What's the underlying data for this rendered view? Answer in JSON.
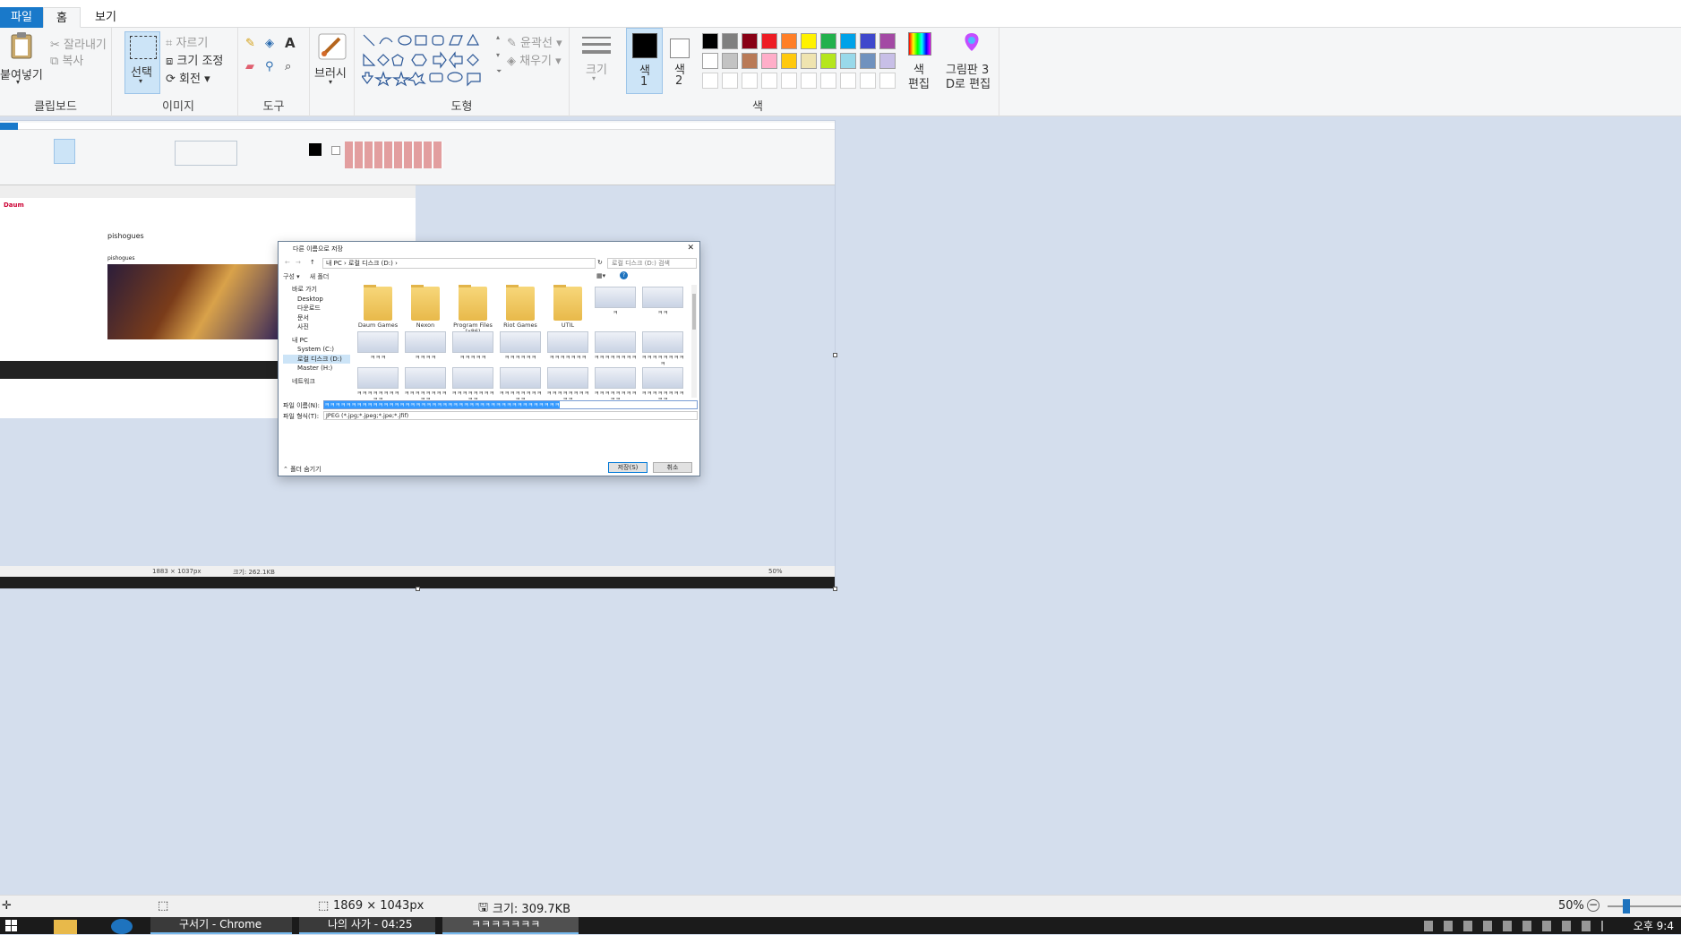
{
  "tabs": {
    "file": "파일",
    "home": "홈",
    "view": "보기"
  },
  "clipboard": {
    "paste": "붙여넣기",
    "cut": "잘라내기",
    "copy": "복사",
    "label": "클립보드"
  },
  "image": {
    "select": "선택",
    "crop": "자르기",
    "resize": "크기 조정",
    "rotate": "회전",
    "label": "이미지"
  },
  "tools": {
    "label": "도구"
  },
  "brushes": {
    "label": "브러시"
  },
  "shapes": {
    "outline": "윤곽선",
    "fill": "채우기",
    "label": "도형"
  },
  "size": {
    "label": "크기"
  },
  "colors": {
    "color1": "색\n1",
    "color1_a": "색",
    "color1_b": "1",
    "color2_a": "색",
    "color2_b": "2",
    "edit_a": "색",
    "edit_b": "편집",
    "paint3d_a": "그림판 3",
    "paint3d_b": "D로 편집",
    "label": "색",
    "palette_row1": [
      "#000000",
      "#7f7f7f",
      "#880015",
      "#ed1c24",
      "#ff7f27",
      "#fff200",
      "#22b14c",
      "#00a2e8",
      "#3f48cc",
      "#a349a4"
    ],
    "palette_row2": [
      "#ffffff",
      "#c3c3c3",
      "#b97a57",
      "#ffaec9",
      "#ffc90e",
      "#efe4b0",
      "#b5e61d",
      "#99d9ea",
      "#7092be",
      "#c8bfe7"
    ]
  },
  "inner": {
    "page_title": "pishogues",
    "page_subtitle": "pishogues",
    "status_dims": "1883 × 1037px",
    "status_size": "크기: 262.1KB",
    "zoom": "50%"
  },
  "dialog": {
    "title": "다른 이름으로 저장",
    "path": "내 PC  ›  로컬 디스크 (D:)  ›",
    "search_placeholder": "로컬 디스크 (D:) 검색",
    "organize": "구성 ▾",
    "new_folder": "새 폴더",
    "nav": [
      "바로 가기",
      "Desktop",
      "다운로드",
      "문서",
      "사진",
      "",
      "내 PC",
      "System (C:)",
      "로컬 디스크 (D:)",
      "Master (H:)",
      "",
      "네트워크"
    ],
    "folders": [
      "Daum Games",
      "Nexon",
      "Program Files (x86)",
      "Riot Games",
      "UTIL",
      "ㅋ",
      "ㅋㅋ"
    ],
    "files_row2": [
      "ㅋㅋㅋ",
      "ㅋㅋㅋㅋ",
      "ㅋㅋㅋㅋㅋ",
      "ㅋㅋㅋㅋㅋㅋ",
      "ㅋㅋㅋㅋㅋㅋㅋ",
      "ㅋㅋㅋㅋㅋㅋㅋㅋ",
      "ㅋㅋㅋㅋㅋㅋㅋㅋㅋ"
    ],
    "files_row3": [
      "ㅋㅋㅋㅋㅋㅋㅋㅋㅋㅋ",
      "ㅋㅋㅋㅋㅋㅋㅋㅋㅋㅋ",
      "ㅋㅋㅋㅋㅋㅋㅋㅋㅋㅋ",
      "ㅋㅋㅋㅋㅋㅋㅋㅋㅋㅋ",
      "ㅋㅋㅋㅋㅋㅋㅋㅋㅋㅋ",
      "ㅋㅋㅋㅋㅋㅋㅋㅋㅋㅋ",
      "ㅋㅋㅋㅋㅋㅋㅋㅋㅋㅋ"
    ],
    "filename_label": "파일 이름(N):",
    "filename_value": "ㅋㅋㅋㅋㅋㅋㅋㅋㅋㅋㅋㅋㅋㅋㅋㅋㅋㅋㅋㅋㅋㅋㅋㅋㅋㅋㅋㅋㅋㅋㅋㅋㅋㅋㅋㅋㅋㅋㅋㅋㅋㅋㅋㅋ",
    "filetype_label": "파일 형식(T):",
    "filetype_value": "JPEG (*.jpg;*.jpeg;*.jpe;*.jfif)",
    "hide_folders": "⌃ 폴더 숨기기",
    "save": "저장(S)",
    "cancel": "취소"
  },
  "status": {
    "dims": "1869 × 1043px",
    "size": "크기: 309.7KB",
    "zoom": "50%"
  },
  "taskbar": {
    "chrome": "구서기 - Chrome",
    "item2": "나의 사가 - 04:25",
    "paint": "ㅋㅋㅋㅋㅋㅋㅋ",
    "clock": "오후 9:4"
  }
}
